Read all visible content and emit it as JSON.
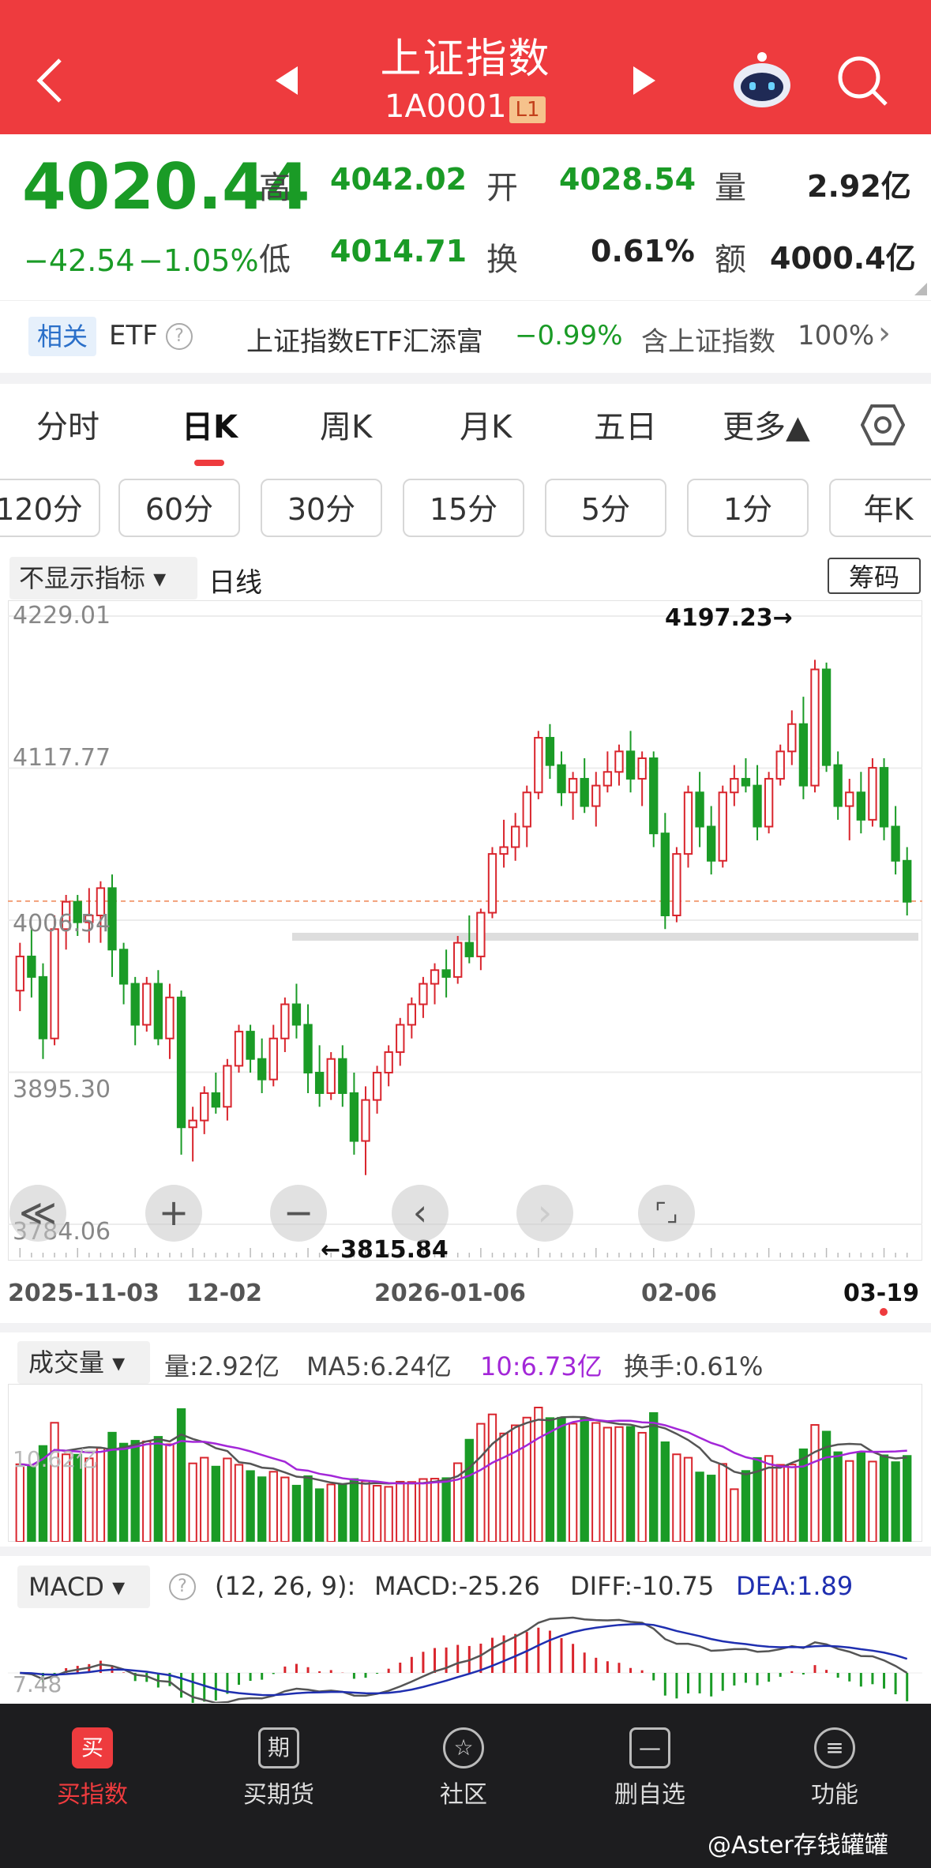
{
  "header": {
    "title": "上证指数",
    "code": "1A0001",
    "level": "L1"
  },
  "quote": {
    "price": "4020.44",
    "change": "−42.54",
    "change_pct": "−1.05%",
    "high_label": "高",
    "high": "4042.02",
    "open_label": "开",
    "open": "4028.54",
    "vol_label": "量",
    "vol": "2.92亿",
    "low_label": "低",
    "low": "4014.71",
    "turn_label": "换",
    "turn": "0.61%",
    "amt_label": "额",
    "amt": "4000.4亿"
  },
  "etf": {
    "badge": "相关",
    "etf_label": "ETF",
    "help": "?",
    "name": "上证指数ETF汇添富",
    "pct": "−0.99%",
    "contain": "含上证指数",
    "contain_pct": "100%",
    "arrow": "›"
  },
  "tabs": [
    "分时",
    "日K",
    "周K",
    "月K",
    "五日",
    "更多▲"
  ],
  "chips": [
    "120分",
    "60分",
    "30分",
    "15分",
    "5分",
    "1分",
    "年K"
  ],
  "kchart": {
    "indicator_select": "不显示指标 ▾",
    "line_type": "日线",
    "chips_btn": "筹码",
    "y_labels": [
      "4229.01",
      "4117.77",
      "4006.54",
      "3895.30",
      "3784.06"
    ],
    "max_label": "4197.23→",
    "min_label": "←3815.84",
    "x_labels": [
      "2025-11-03",
      "12-02",
      "2026-01-06",
      "02-06",
      "03-19"
    ],
    "controls": [
      "≪",
      "+",
      "−",
      "‹",
      "›",
      "⌜⌟"
    ]
  },
  "volume": {
    "select": "成交量 ▾",
    "vol": "量:2.92亿",
    "ma5": "MA5:6.24亿",
    "ma10": "10:6.73亿",
    "turn": "换手:0.61%",
    "axis": "10.62亿"
  },
  "macd": {
    "select": "MACD ▾",
    "help": "?",
    "params": "(12, 26, 9):",
    "macd": "MACD:-25.26",
    "diff": "DIFF:-10.75",
    "dea": "DEA:1.89",
    "axis": "7.48"
  },
  "nav": [
    {
      "icon": "买",
      "label": "买指数"
    },
    {
      "icon": "期",
      "label": "买期货"
    },
    {
      "icon": "☆",
      "label": "社区"
    },
    {
      "icon": "—",
      "label": "删自选"
    },
    {
      "icon": "≡",
      "label": "功能"
    }
  ],
  "watermark": "@Aster存钱罐罐",
  "chart_data": {
    "type": "candlestick",
    "ylim": [
      3784.06,
      4229.01
    ],
    "y_ticks": [
      4229.01,
      4117.77,
      4006.54,
      3895.3,
      3784.06
    ],
    "x_ticks": [
      "2025-11-03",
      "12-02",
      "2026-01-06",
      "02-06",
      "03-19"
    ],
    "annotations": [
      {
        "text": "4197.23",
        "kind": "max"
      },
      {
        "text": "3815.84",
        "kind": "min"
      }
    ],
    "ohlc": [
      [
        3955,
        3990,
        3940,
        3980
      ],
      [
        3980,
        4000,
        3950,
        3965
      ],
      [
        3965,
        3975,
        3905,
        3920
      ],
      [
        3920,
        4010,
        3915,
        4000
      ],
      [
        4000,
        4025,
        3985,
        4020
      ],
      [
        4020,
        4025,
        3995,
        4005
      ],
      [
        4005,
        4030,
        3990,
        4010
      ],
      [
        4010,
        4035,
        3990,
        4030
      ],
      [
        4030,
        4040,
        3965,
        3985
      ],
      [
        3985,
        3990,
        3945,
        3960
      ],
      [
        3960,
        3965,
        3915,
        3930
      ],
      [
        3930,
        3965,
        3925,
        3960
      ],
      [
        3960,
        3970,
        3915,
        3920
      ],
      [
        3920,
        3960,
        3905,
        3950
      ],
      [
        3950,
        3955,
        3835,
        3855
      ],
      [
        3855,
        3870,
        3830,
        3860
      ],
      [
        3860,
        3885,
        3850,
        3880
      ],
      [
        3880,
        3895,
        3865,
        3870
      ],
      [
        3870,
        3905,
        3860,
        3900
      ],
      [
        3900,
        3930,
        3895,
        3925
      ],
      [
        3925,
        3930,
        3895,
        3905
      ],
      [
        3905,
        3920,
        3880,
        3890
      ],
      [
        3890,
        3930,
        3885,
        3920
      ],
      [
        3920,
        3950,
        3910,
        3945
      ],
      [
        3945,
        3960,
        3920,
        3930
      ],
      [
        3930,
        3945,
        3880,
        3895
      ],
      [
        3895,
        3915,
        3870,
        3880
      ],
      [
        3880,
        3910,
        3875,
        3905
      ],
      [
        3905,
        3915,
        3870,
        3880
      ],
      [
        3880,
        3895,
        3835,
        3845
      ],
      [
        3845,
        3885,
        3820,
        3875
      ],
      [
        3875,
        3900,
        3865,
        3895
      ],
      [
        3895,
        3915,
        3885,
        3910
      ],
      [
        3910,
        3935,
        3900,
        3930
      ],
      [
        3930,
        3950,
        3920,
        3945
      ],
      [
        3945,
        3965,
        3935,
        3960
      ],
      [
        3960,
        3975,
        3945,
        3970
      ],
      [
        3970,
        3985,
        3950,
        3965
      ],
      [
        3965,
        3995,
        3960,
        3990
      ],
      [
        3990,
        4010,
        3975,
        3980
      ],
      [
        3980,
        4015,
        3970,
        4012
      ],
      [
        4012,
        4060,
        4008,
        4055
      ],
      [
        4055,
        4080,
        4045,
        4060
      ],
      [
        4060,
        4085,
        4050,
        4075
      ],
      [
        4075,
        4105,
        4060,
        4100
      ],
      [
        4100,
        4145,
        4095,
        4140
      ],
      [
        4140,
        4150,
        4110,
        4120
      ],
      [
        4120,
        4130,
        4090,
        4100
      ],
      [
        4100,
        4115,
        4080,
        4110
      ],
      [
        4110,
        4125,
        4085,
        4090
      ],
      [
        4090,
        4115,
        4075,
        4105
      ],
      [
        4105,
        4130,
        4100,
        4115
      ],
      [
        4115,
        4135,
        4105,
        4130
      ],
      [
        4130,
        4145,
        4100,
        4110
      ],
      [
        4110,
        4130,
        4090,
        4125
      ],
      [
        4125,
        4130,
        4060,
        4070
      ],
      [
        4070,
        4085,
        4000,
        4010
      ],
      [
        4010,
        4060,
        4005,
        4055
      ],
      [
        4055,
        4105,
        4045,
        4100
      ],
      [
        4100,
        4115,
        4060,
        4075
      ],
      [
        4075,
        4090,
        4040,
        4050
      ],
      [
        4050,
        4105,
        4045,
        4100
      ],
      [
        4100,
        4120,
        4090,
        4110
      ],
      [
        4110,
        4125,
        4100,
        4105
      ],
      [
        4105,
        4120,
        4065,
        4075
      ],
      [
        4075,
        4115,
        4070,
        4110
      ],
      [
        4110,
        4135,
        4105,
        4130
      ],
      [
        4130,
        4160,
        4120,
        4150
      ],
      [
        4150,
        4170,
        4095,
        4105
      ],
      [
        4105,
        4197,
        4100,
        4190
      ],
      [
        4190,
        4195,
        4115,
        4120
      ],
      [
        4120,
        4130,
        4080,
        4090
      ],
      [
        4090,
        4110,
        4065,
        4100
      ],
      [
        4100,
        4115,
        4070,
        4080
      ],
      [
        4080,
        4125,
        4075,
        4118
      ],
      [
        4118,
        4125,
        4065,
        4075
      ],
      [
        4075,
        4090,
        4040,
        4050
      ],
      [
        4050,
        4060,
        4010,
        4020
      ]
    ]
  }
}
